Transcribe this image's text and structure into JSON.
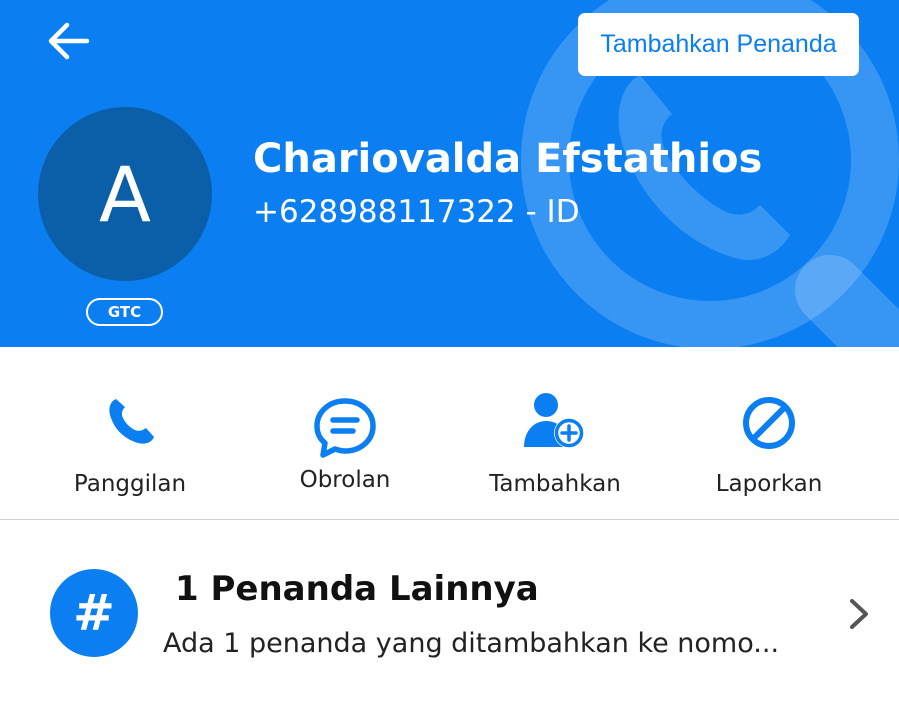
{
  "colors": {
    "brand_blue": "#0b7ff2",
    "avatar_bg": "#0b5ea8",
    "text_dark": "#222222",
    "divider": "#cfcfcf"
  },
  "header": {
    "back_icon": "arrow-left-icon",
    "add_tag_label": "Tambahkan Penanda",
    "watermark_icon": "phone-search-icon"
  },
  "contact": {
    "avatar_letter": "A",
    "badge": "GTC",
    "name": "Chariovalda Efstathios",
    "phone": "+628988117322 - ID"
  },
  "actions": [
    {
      "label": "Panggilan",
      "icon": "phone-icon"
    },
    {
      "label": "Obrolan",
      "icon": "chat-bubble-icon"
    },
    {
      "label": "Tambahkan",
      "icon": "add-person-icon"
    },
    {
      "label": "Laporkan",
      "icon": "block-icon"
    }
  ],
  "tags_section": {
    "icon": "hashtag-icon",
    "icon_glyph": "#",
    "title": "1 Penanda Lainnya",
    "description": "Ada 1 penanda yang ditambahkan ke nomo...",
    "chevron_icon": "chevron-right-icon"
  }
}
